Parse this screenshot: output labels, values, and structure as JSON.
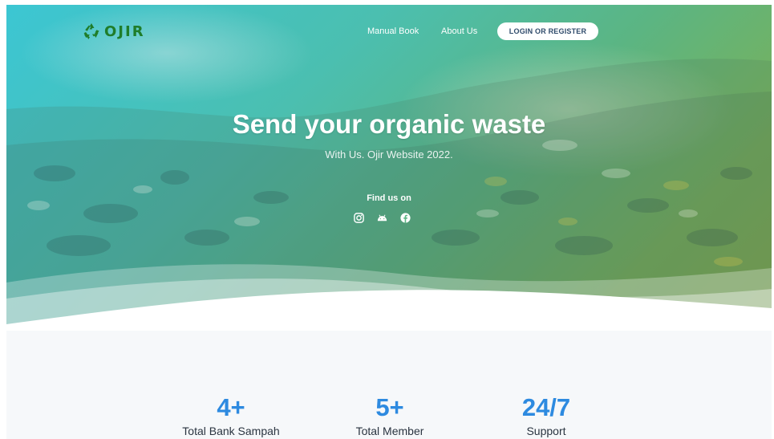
{
  "brand": {
    "name": "OJIR",
    "icon": "recycle-icon",
    "color": "#1f7d2a"
  },
  "nav": {
    "links": [
      {
        "label": "Manual Book"
      },
      {
        "label": "About Us"
      }
    ],
    "login_label": "LOGIN OR REGISTER"
  },
  "hero": {
    "title": "Send your organic waste",
    "subtitle": "With Us. Ojir Website 2022.",
    "find_us_label": "Find us on",
    "socials": [
      {
        "icon": "instagram-icon"
      },
      {
        "icon": "android-icon"
      },
      {
        "icon": "facebook-icon"
      }
    ]
  },
  "stats": [
    {
      "value": "4+",
      "label": "Total Bank Sampah"
    },
    {
      "value": "5+",
      "label": "Total Member"
    },
    {
      "value": "24/7",
      "label": "Support"
    }
  ],
  "colors": {
    "accent": "#2d8ae0",
    "hero_start": "#3cc6d3",
    "hero_end": "#86ad4c"
  }
}
